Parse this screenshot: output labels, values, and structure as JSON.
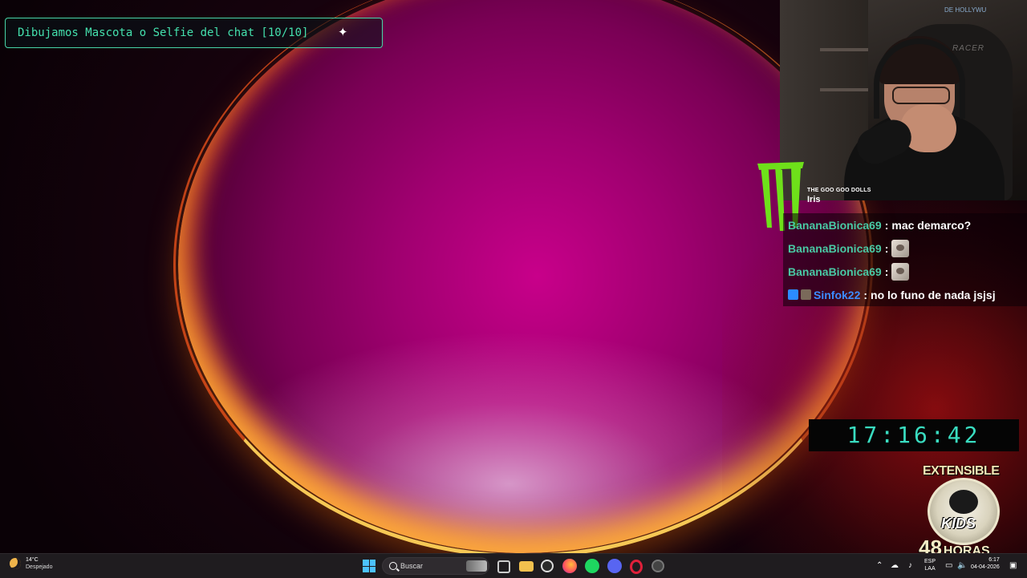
{
  "overlay": {
    "title": "Dibujamos Mascota o Selfie del chat [10/10]",
    "title_icon": "sparkle-icon"
  },
  "webcam": {
    "wall_text": "DE HOLLYWU",
    "chair_brand": "RACER"
  },
  "now_playing": {
    "artist": "THE GOO GOO DOLLS",
    "title": "Iris"
  },
  "chat": {
    "messages": [
      {
        "user": "BananaBionica69",
        "sep": ":",
        "text": "mac demarco?"
      },
      {
        "user": "BananaBionica69",
        "sep": ":",
        "text": ""
      },
      {
        "user": "BananaBionica69",
        "sep": ":",
        "text": ""
      },
      {
        "user": "Sinfok22",
        "sep": ":",
        "text": "no lo funo de nada jsjsj"
      }
    ]
  },
  "timer": "17:16:42",
  "subathon": {
    "label": "EXTENSIBLE",
    "badge_text": "KIDS",
    "hours": "48",
    "hours_word": "HORAS"
  },
  "taskbar": {
    "weather_temp": "14°C",
    "weather_desc": "Despejado",
    "search_placeholder": "Buscar",
    "lang_top": "ESP",
    "lang_bottom": "LAA",
    "time": "6:17",
    "date": "04-04-2026"
  },
  "colors": {
    "overlay_accent": "#44e0ad",
    "chat_name_green": "#49c9a4",
    "chat_name_blue": "#3d8cff",
    "timer": "#39dcc0"
  }
}
